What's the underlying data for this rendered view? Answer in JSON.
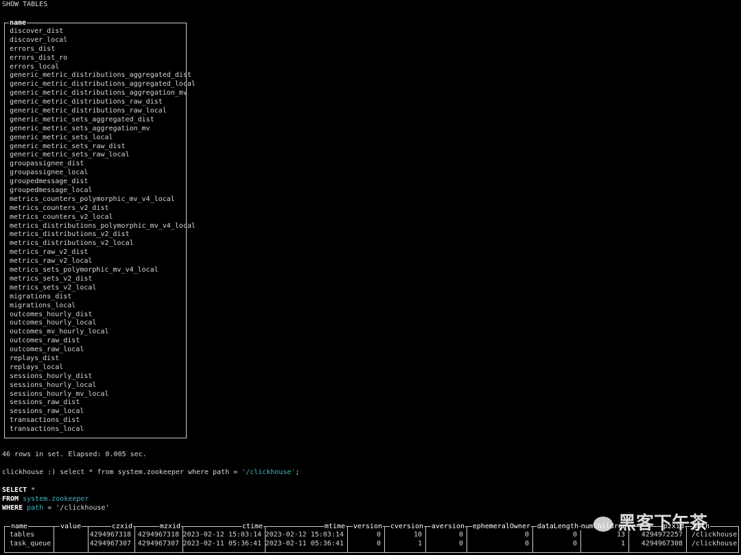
{
  "command": "SHOW TABLES",
  "list": {
    "header": "name",
    "items": [
      "discover_dist",
      "discover_local",
      "errors_dist",
      "errors_dist_ro",
      "errors_local",
      "generic_metric_distributions_aggregated_dist",
      "generic_metric_distributions_aggregated_local",
      "generic_metric_distributions_aggregation_mv",
      "generic_metric_distributions_raw_dist",
      "generic_metric_distributions_raw_local",
      "generic_metric_sets_aggregated_dist",
      "generic_metric_sets_aggregation_mv",
      "generic_metric_sets_local",
      "generic_metric_sets_raw_dist",
      "generic_metric_sets_raw_local",
      "groupassignee_dist",
      "groupassignee_local",
      "groupedmessage_dist",
      "groupedmessage_local",
      "metrics_counters_polymorphic_mv_v4_local",
      "metrics_counters_v2_dist",
      "metrics_counters_v2_local",
      "metrics_distributions_polymorphic_mv_v4_local",
      "metrics_distributions_v2_dist",
      "metrics_distributions_v2_local",
      "metrics_raw_v2_dist",
      "metrics_raw_v2_local",
      "metrics_sets_polymorphic_mv_v4_local",
      "metrics_sets_v2_dist",
      "metrics_sets_v2_local",
      "migrations_dist",
      "migrations_local",
      "outcomes_hourly_dist",
      "outcomes_hourly_local",
      "outcomes_mv_hourly_local",
      "outcomes_raw_dist",
      "outcomes_raw_local",
      "replays_dist",
      "replays_local",
      "sessions_hourly_dist",
      "sessions_hourly_local",
      "sessions_hourly_mv_local",
      "sessions_raw_dist",
      "sessions_raw_local",
      "transactions_dist",
      "transactions_local"
    ]
  },
  "status": "46 rows in set. Elapsed: 0.005 sec.",
  "prompt": {
    "prefix": "clickhouse :) select * from system.zookeeper where path = ",
    "literal": "'/clickhouse'",
    "suffix": ";"
  },
  "formatted": {
    "kw1": "SELECT",
    "l1": " *",
    "kw2": "FROM",
    "l2": " system.zookeeper",
    "kw3": "WHERE",
    "l3a": " path",
    "l3b": " = '/clickhouse'"
  },
  "result": {
    "columns": [
      "name",
      "value",
      "czxid",
      "mzxid",
      "ctime",
      "mtime",
      "version",
      "cversion",
      "aversion",
      "ephemeralOwner",
      "dataLength",
      "numChildren",
      "pzxid",
      "path"
    ],
    "rows": [
      [
        "tables",
        "",
        "4294967318",
        "4294967318",
        "2023-02-12 15:03:14",
        "2023-02-12 15:03:14",
        "0",
        "10",
        "0",
        "0",
        "0",
        "13",
        "4294972257",
        "/clickhouse"
      ],
      [
        "task_queue",
        "",
        "4294967307",
        "4294967307",
        "2023-02-11 05:36:41",
        "2023-02-11 05:36:41",
        "0",
        "1",
        "0",
        "0",
        "0",
        "1",
        "4294967308",
        "/clickhouse"
      ]
    ]
  },
  "watermark": "黑客下午茶",
  "colors": {
    "string": "#3fb8c0",
    "text": "#d8d8d8",
    "background": "#000000"
  }
}
